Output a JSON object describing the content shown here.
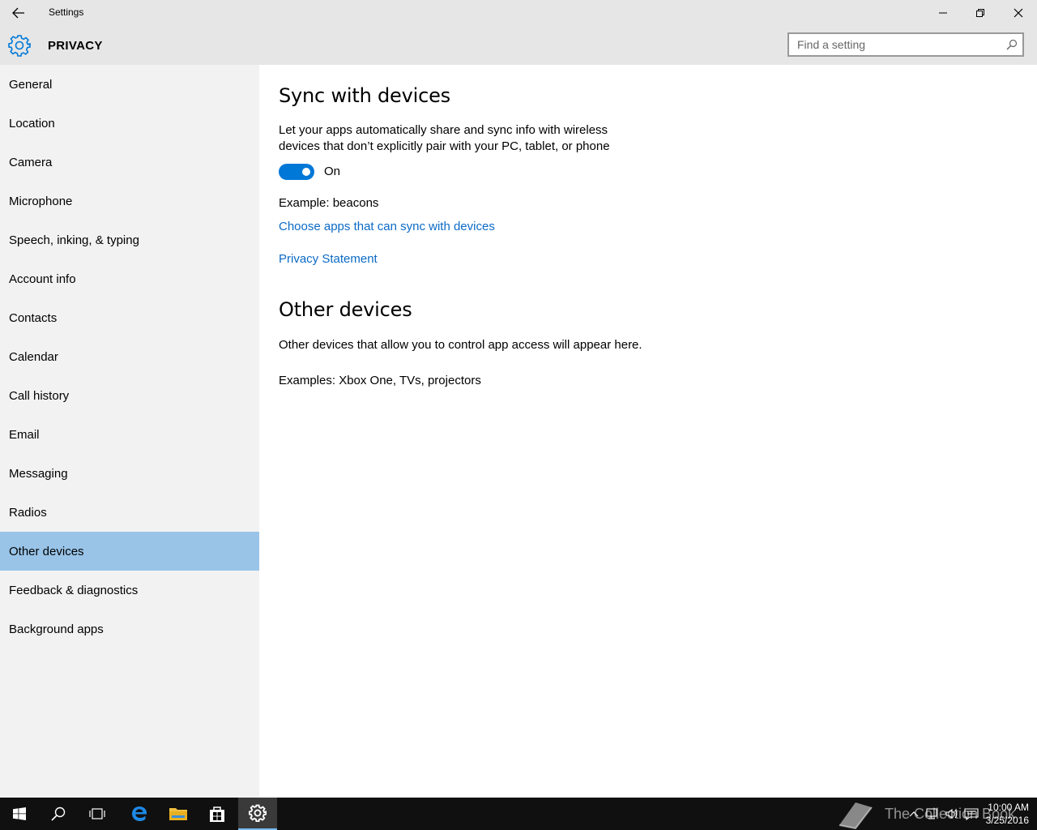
{
  "window": {
    "title": "Settings",
    "section_title": "PRIVACY"
  },
  "search": {
    "placeholder": "Find a setting"
  },
  "sidebar": {
    "items": [
      {
        "label": "General"
      },
      {
        "label": "Location"
      },
      {
        "label": "Camera"
      },
      {
        "label": "Microphone"
      },
      {
        "label": "Speech, inking, & typing"
      },
      {
        "label": "Account info"
      },
      {
        "label": "Contacts"
      },
      {
        "label": "Calendar"
      },
      {
        "label": "Call history"
      },
      {
        "label": "Email"
      },
      {
        "label": "Messaging"
      },
      {
        "label": "Radios"
      },
      {
        "label": "Other devices",
        "selected": true
      },
      {
        "label": "Feedback & diagnostics"
      },
      {
        "label": "Background apps"
      }
    ]
  },
  "main": {
    "sync_heading": "Sync with devices",
    "sync_description": "Let your apps automatically share and sync info with wireless devices that don’t explicitly pair with your PC, tablet, or phone",
    "toggle_state": "On",
    "toggle_on": true,
    "example_text": "Example: beacons",
    "choose_apps_link": "Choose apps that can sync with devices",
    "privacy_link": "Privacy Statement",
    "other_heading": "Other devices",
    "other_description": "Other devices that allow you to control app access will appear here.",
    "other_examples": "Examples: Xbox One, TVs, projectors"
  },
  "taskbar": {
    "time": "10:00 AM",
    "date": "3/25/2016",
    "watermark": "The Collection Book"
  },
  "colors": {
    "accent": "#0078d7",
    "link": "#0b6ac6",
    "selected_nav": "#99c4e8"
  }
}
